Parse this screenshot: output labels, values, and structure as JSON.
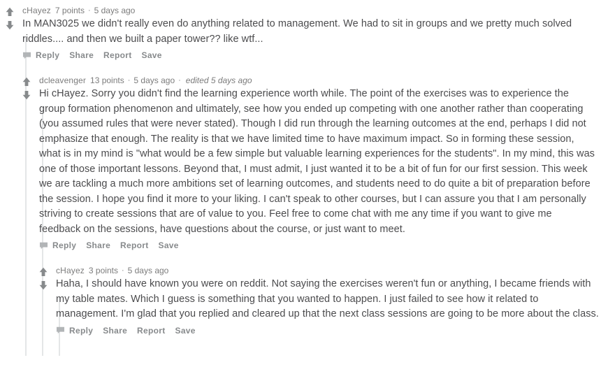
{
  "thread": {
    "comments": [
      {
        "id": "comment-1",
        "author": "cHayez",
        "points": "7 points",
        "separator": "·",
        "timestamp": "5 days ago",
        "edited": "",
        "body": "In MAN3025 we didn't really even do anything related to management. We had to sit in groups and we pretty much solved riddles.... and then we built a paper tower?? like wtf...",
        "actions": {
          "reply": "Reply",
          "share": "Share",
          "report": "Report",
          "save": "Save"
        }
      },
      {
        "id": "comment-2",
        "author": "dcleavenger",
        "points": "13 points",
        "separator": "·",
        "timestamp": "5 days ago",
        "edited": "edited 5 days ago",
        "edited_separator": "·",
        "body": "Hi cHayez. Sorry you didn't find the learning experience worth while. The point of the exercises was to experience the group formation phenomenon and ultimately, see how you ended up competing with one another rather than cooperating (you assumed rules that were never stated). Though I did run through the learning outcomes at the end, perhaps I did not emphasize that enough. The reality is that we have limited time to have maximum impact. So in forming these session, what is in my mind is \"what would be a few simple but valuable learning experiences for the students\". In my mind, this was one of those important lessons. Beyond that, I must admit, I just wanted it to be a bit of fun for our first session. This week we are tackling a much more ambitions set of learning outcomes, and students need to do quite a bit of preparation before the session. I hope you find it more to your liking. I can't speak to other courses, but I can assure you that I am personally striving to create sessions that are of value to you. Feel free to come chat with me any time if you want to give me feedback on the sessions, have questions about the course, or just want to meet.",
        "actions": {
          "reply": "Reply",
          "share": "Share",
          "report": "Report",
          "save": "Save"
        }
      },
      {
        "id": "comment-3",
        "author": "cHayez",
        "points": "3 points",
        "separator": "·",
        "timestamp": "5 days ago",
        "edited": "",
        "body": "Haha, I should have known you were on reddit. Not saying the exercises weren't fun or anything, I became friends with my table mates. Which I guess is something that you wanted to happen. I just failed to see how it related to management. I'm glad that you replied and cleared up that the next class sessions are going to be more about the class.",
        "actions": {
          "reply": "Reply",
          "share": "Share",
          "report": "Report",
          "save": "Save"
        }
      }
    ]
  },
  "icons": {
    "upvote": "upvote-arrow-icon",
    "downvote": "downvote-arrow-icon",
    "reply_bubble": "speech-bubble-icon"
  },
  "colors": {
    "text": "#4b4b4d",
    "meta": "#7c7c7c",
    "action": "#878a8c",
    "arrow": "#878a8c",
    "threadline": "#e4e6e7",
    "background": "#ffffff"
  }
}
